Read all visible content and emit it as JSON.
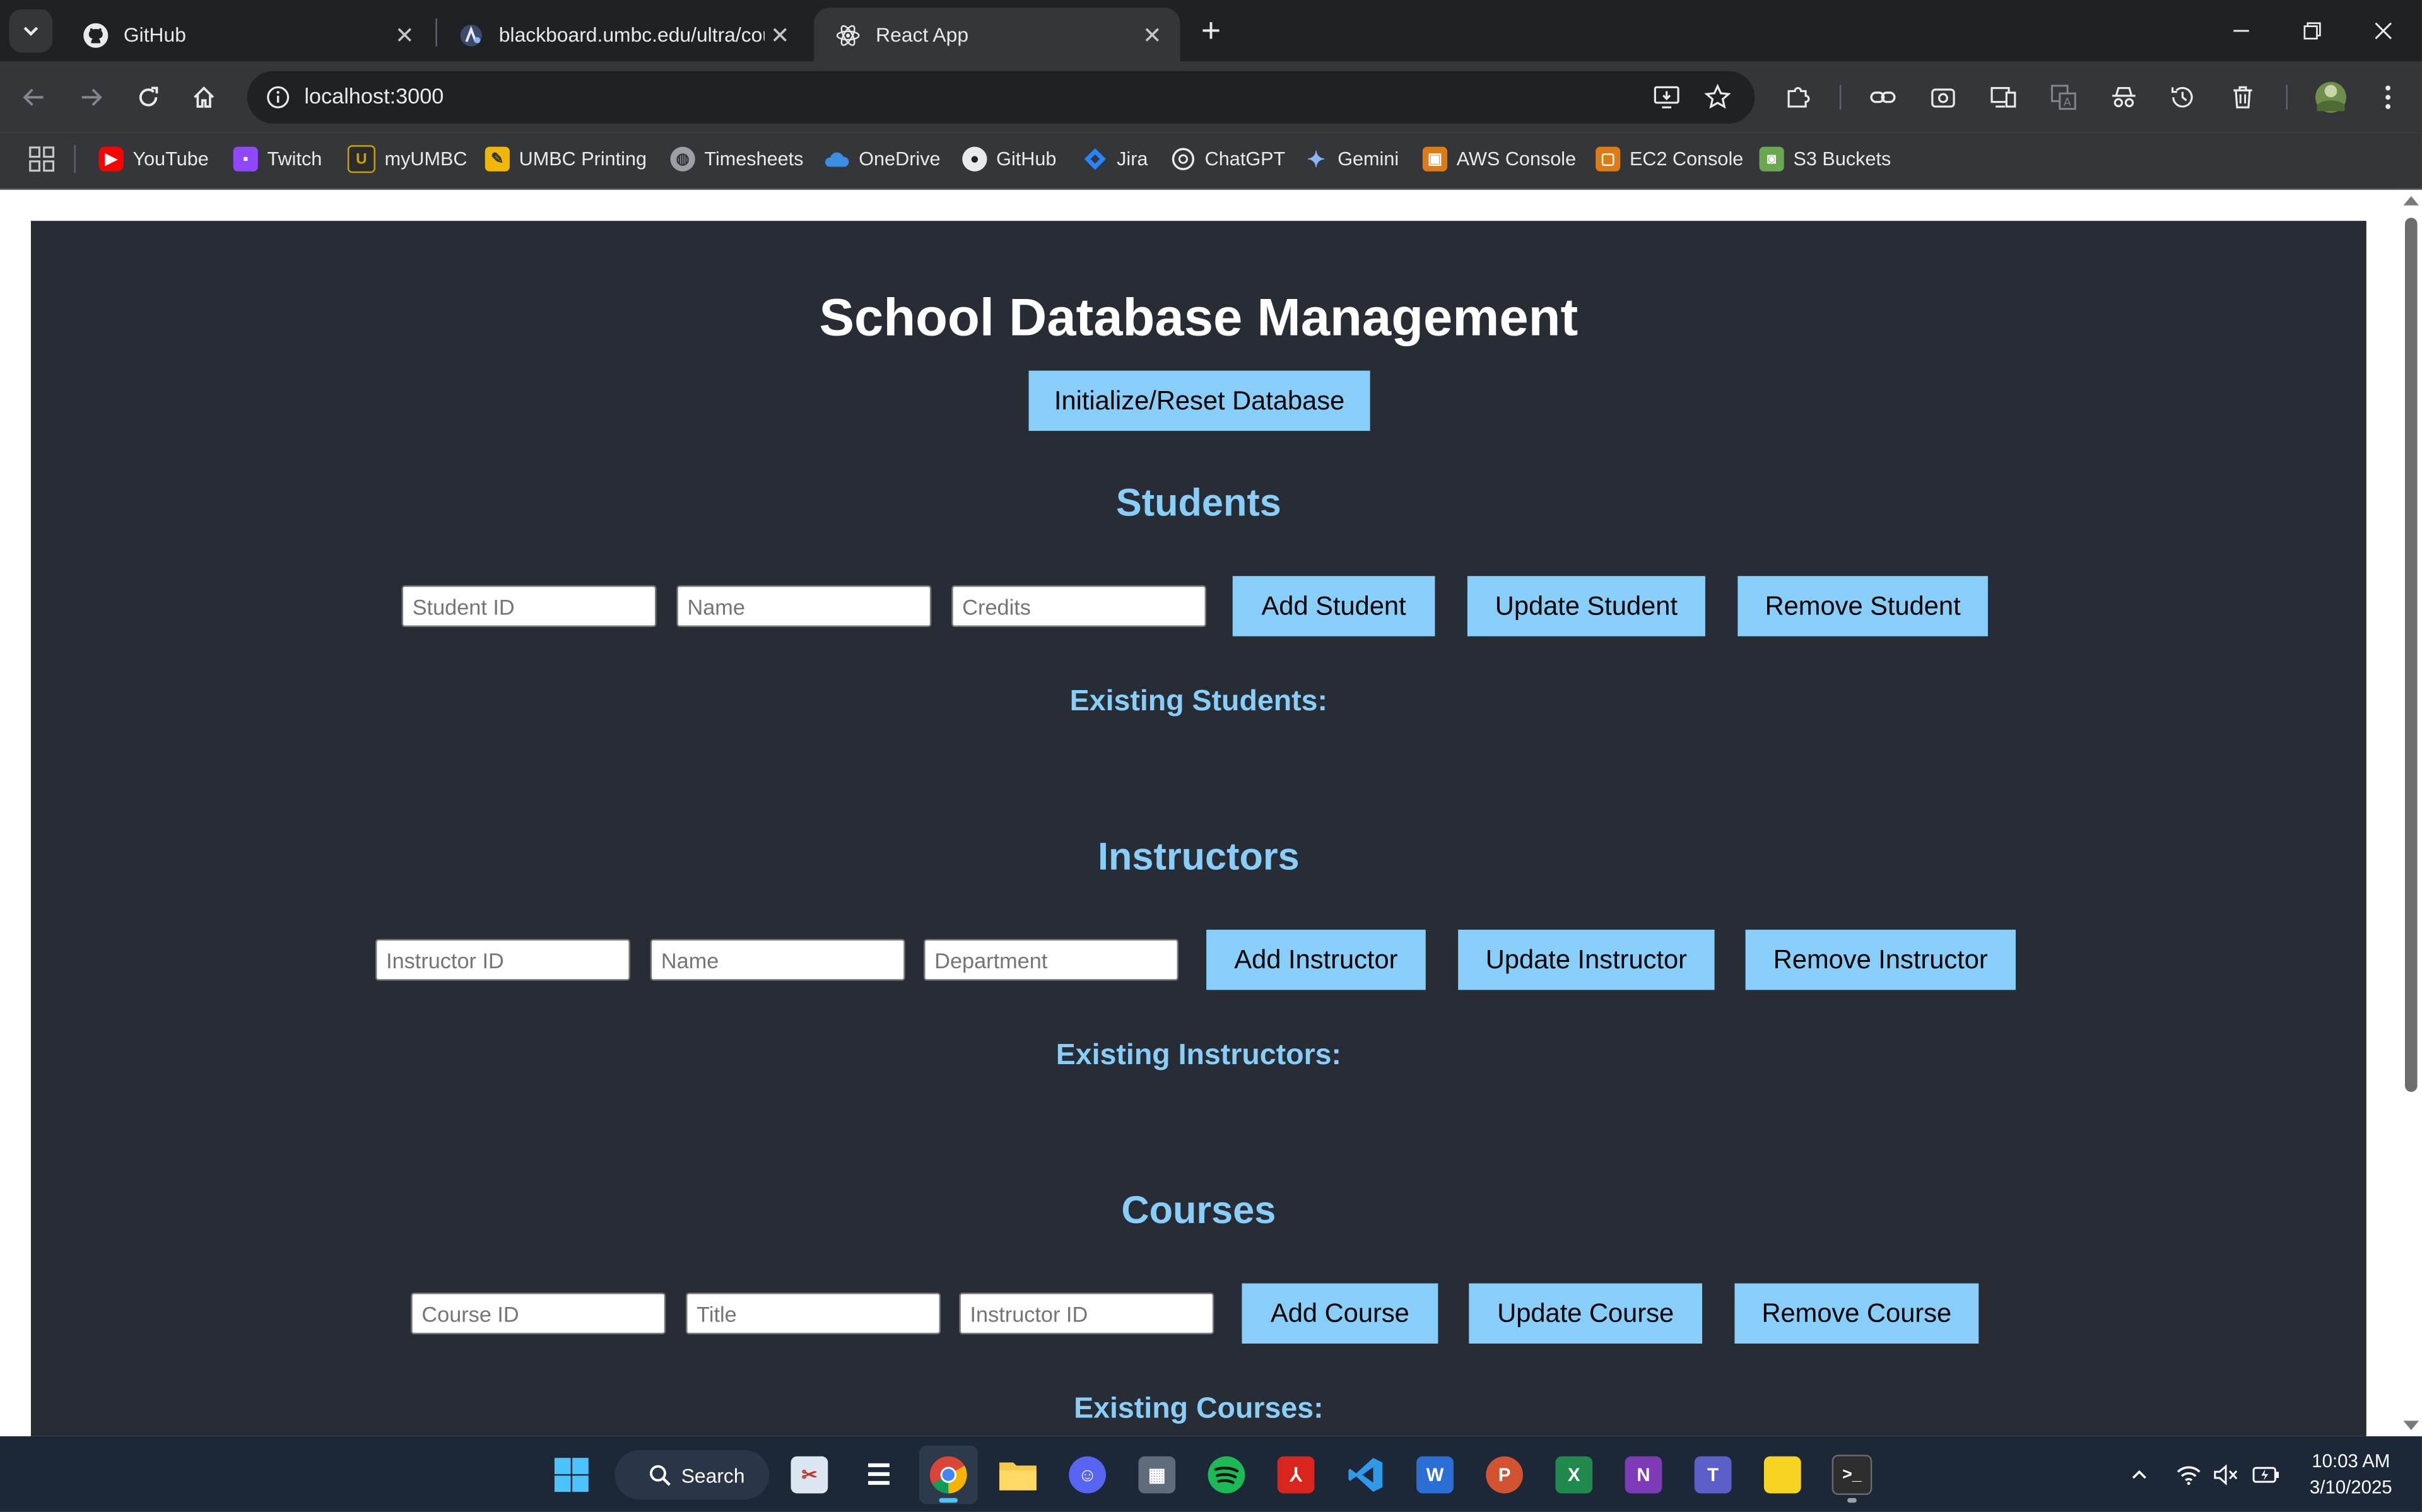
{
  "browser": {
    "tabs": [
      {
        "title": "GitHub",
        "icon": "github-icon"
      },
      {
        "title": "blackboard.umbc.edu/ultra/cou",
        "icon": "blackboard-icon"
      },
      {
        "title": "React App",
        "icon": "react-icon",
        "active": true
      }
    ],
    "url": "localhost:3000",
    "bookmarks": [
      {
        "label": "YouTube",
        "icon": "youtube-icon",
        "color": "#ff0000"
      },
      {
        "label": "Twitch",
        "icon": "twitch-icon",
        "color": "#9146ff"
      },
      {
        "label": "myUMBC",
        "icon": "umbc-icon",
        "color": "#c8a200"
      },
      {
        "label": "UMBC Printing",
        "icon": "printing-icon",
        "color": "#f2b705"
      },
      {
        "label": "Timesheets",
        "icon": "globe-icon",
        "color": "#9aa0a6"
      },
      {
        "label": "OneDrive",
        "icon": "onedrive-icon",
        "color": "#3a8ee6"
      },
      {
        "label": "GitHub",
        "icon": "github-icon",
        "color": "#e8eaed"
      },
      {
        "label": "Jira",
        "icon": "jira-icon",
        "color": "#2684ff"
      },
      {
        "label": "ChatGPT",
        "icon": "chatgpt-icon",
        "color": "#e8eaed"
      },
      {
        "label": "Gemini",
        "icon": "gemini-icon",
        "color": "#8ab4f8"
      },
      {
        "label": "AWS Console",
        "icon": "aws-icon",
        "color": "#e07b14"
      },
      {
        "label": "EC2 Console",
        "icon": "ec2-icon",
        "color": "#e07b14"
      },
      {
        "label": "S3 Buckets",
        "icon": "s3-icon",
        "color": "#6aa84f"
      }
    ]
  },
  "app": {
    "title": "School Database Management",
    "reset_button": "Initialize/Reset Database",
    "accent": "#87cefa",
    "background": "#282c34",
    "students": {
      "heading": "Students",
      "placeholders": {
        "id": "Student ID",
        "name": "Name",
        "extra": "Credits"
      },
      "add": "Add Student",
      "update": "Update Student",
      "remove": "Remove Student",
      "existing": "Existing Students:"
    },
    "instructors": {
      "heading": "Instructors",
      "placeholders": {
        "id": "Instructor ID",
        "name": "Name",
        "extra": "Department"
      },
      "add": "Add Instructor",
      "update": "Update Instructor",
      "remove": "Remove Instructor",
      "existing": "Existing Instructors:"
    },
    "courses": {
      "heading": "Courses",
      "placeholders": {
        "id": "Course ID",
        "name": "Title",
        "extra": "Instructor ID"
      },
      "add": "Add Course",
      "update": "Update Course",
      "remove": "Remove Course",
      "existing": "Existing Courses:"
    }
  },
  "taskbar": {
    "search_label": "Search",
    "time": "10:03 AM",
    "date": "3/10/2025"
  }
}
